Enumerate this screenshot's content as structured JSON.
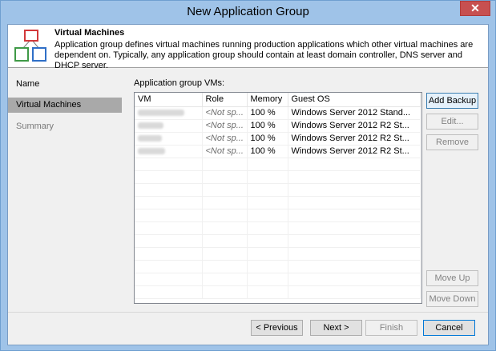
{
  "window": {
    "title": "New Application Group",
    "close_label": "✕"
  },
  "header": {
    "title": "Virtual Machines",
    "description": "Application group defines virtual machines running production applications which other virtual machines are dependent on. Typically, any application group should contain at least domain controller, DNS server and DHCP server.",
    "icon": "application-group-icon"
  },
  "nav": {
    "items": [
      {
        "label": "Name",
        "state": "normal"
      },
      {
        "label": "Virtual Machines",
        "state": "active"
      },
      {
        "label": "Summary",
        "state": "disabled"
      }
    ]
  },
  "vms": {
    "label": "Application group VMs:",
    "columns": [
      "VM",
      "Role",
      "Memory",
      "Guest OS"
    ],
    "rows": [
      {
        "vm": "",
        "role": "<Not sp...",
        "memory": "100 %",
        "guest_os": "Windows Server 2012 Stand..."
      },
      {
        "vm": "",
        "role": "<Not sp...",
        "memory": "100 %",
        "guest_os": "Windows Server 2012 R2 St..."
      },
      {
        "vm": "",
        "role": "<Not sp...",
        "memory": "100 %",
        "guest_os": "Windows Server 2012 R2 St..."
      },
      {
        "vm": "",
        "role": "<Not sp...",
        "memory": "100 %",
        "guest_os": "Windows Server 2012 R2 St..."
      }
    ]
  },
  "side_buttons": {
    "add_backup": "Add Backup",
    "edit": "Edit...",
    "remove": "Remove",
    "move_up": "Move Up",
    "move_down": "Move Down"
  },
  "footer": {
    "previous": "< Previous",
    "next": "Next >",
    "finish": "Finish",
    "cancel": "Cancel"
  },
  "colors": {
    "title_bar": "#9fc3e8",
    "close_button": "#c75050",
    "active_nav": "#a9a9a9"
  }
}
